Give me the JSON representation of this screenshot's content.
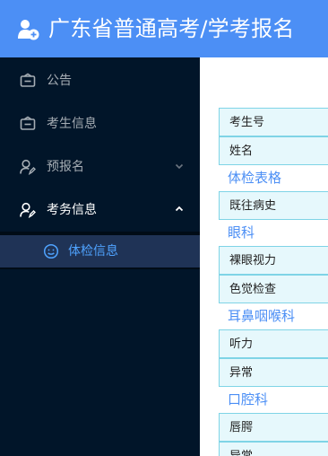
{
  "header": {
    "title": "广东省普通高考/学考报名"
  },
  "sidebar": {
    "items": [
      {
        "label": "公告"
      },
      {
        "label": "考生信息"
      },
      {
        "label": "预报名"
      },
      {
        "label": "考务信息"
      }
    ],
    "subitems": [
      {
        "label": "体检信息"
      }
    ]
  },
  "form": {
    "rows": {
      "candidate_no": "考生号",
      "name": "姓名",
      "past_history": "既往病史",
      "naked_vision": "裸眼视力",
      "color_vision": "色觉检查",
      "hearing": "听力",
      "ear_abnormal": "异常",
      "lips_palate": "唇腭",
      "mouth_abnormal": "异常"
    },
    "sections": {
      "exam_form": "体检表格",
      "eye": "眼科",
      "ent": "耳鼻咽喉科",
      "oral": "口腔科"
    }
  },
  "colors": {
    "header": "#4c8ff5",
    "sidebar": "#011529",
    "active_bg": "#1f3356",
    "active_text": "#4fa3ff",
    "cell_bg": "#e6f8fc",
    "cell_border": "#7fd4e6"
  }
}
